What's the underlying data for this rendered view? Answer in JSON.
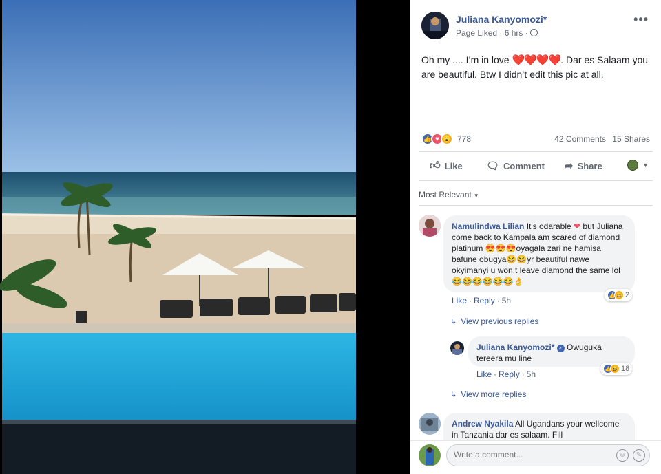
{
  "post": {
    "author": "Juliana Kanyomozi*",
    "meta": "Page Liked · 6 hrs ·",
    "text_before": "Oh my .... I’m in love ",
    "hearts": "❤️❤️❤️❤️",
    "text_after": ". Dar es Salaam you are beautiful. Btw I didn’t edit this pic at all.",
    "reaction_count": "778",
    "comments_count": "42 Comments",
    "shares_count": "15 Shares"
  },
  "actions": {
    "like": "Like",
    "comment": "Comment",
    "share": "Share"
  },
  "icons": {
    "like": "thumbs-up-icon",
    "comment": "speech-bubble-icon",
    "share": "share-arrow-icon",
    "more": "more-options-icon",
    "globe": "globe-icon",
    "emoji": "emoji-icon",
    "sticker": "sticker-icon"
  },
  "sort_label": "Most Relevant",
  "comments": [
    {
      "name": "Namulindwa Lilian",
      "text_1": " It's odarable ",
      "heart": "❤",
      "text_2": " but Juliana come back to Kampala am scared of diamond platinum ",
      "emo_1": "😍😍😍",
      "text_3": "oyagala zari ne hamisa bafune obugya",
      "emo_2": "😆😆",
      "text_4": "yr beautiful nawe okyimanyi u won,t leave diamond the same lol",
      "emo_3": "😂😂😂😂😂😂👌",
      "like": "Like",
      "reply": "Reply",
      "time": "5h",
      "reaction_count": "2"
    }
  ],
  "view_previous": "View previous replies",
  "reply": {
    "name": "Juliana Kanyomozi*",
    "text": " Owuguka tereera mu line",
    "like": "Like",
    "reply": "Reply",
    "time": "5h",
    "reaction_count": "18"
  },
  "view_more": "View more replies",
  "comment2": {
    "name": "Andrew Nyakila",
    "text": " All Ugandans your wellcome in Tanzania dar es salaam. Fill"
  },
  "write_placeholder": "Write a comment...",
  "colors": {
    "link": "#385898",
    "like_blue": "#4267b2",
    "love_red": "#f25268",
    "sky": "#4a7fc4",
    "pool": "#22a9d9"
  }
}
